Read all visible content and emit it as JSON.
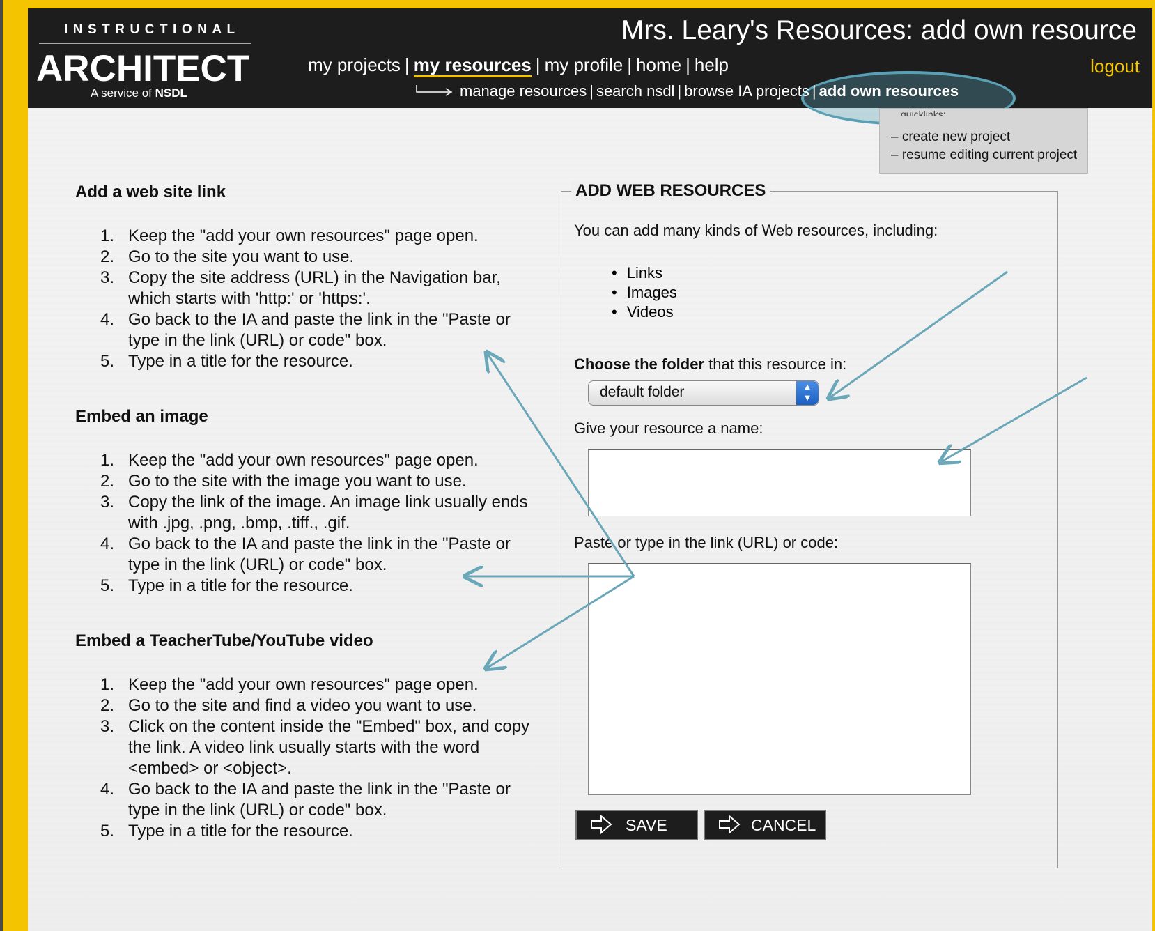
{
  "header": {
    "logo_top": "INSTRUCTIONAL",
    "logo_main": "ARCHITECT",
    "logo_sub": "A service of",
    "logo_nsdl": "NSDL",
    "title": "Mrs. Leary's Resources: add own resource",
    "nav": [
      {
        "label": "my projects",
        "active": false
      },
      {
        "label": "my resources",
        "active": true
      },
      {
        "label": "my profile",
        "active": false
      },
      {
        "label": "home",
        "active": false
      },
      {
        "label": "help",
        "active": false
      }
    ],
    "logout": "logout",
    "subnav": [
      {
        "label": "manage resources"
      },
      {
        "label": "search nsdl"
      },
      {
        "label": "browse IA projects"
      },
      {
        "label": "add own resources"
      }
    ],
    "colors": {
      "bar": "#1d1d1d",
      "accent": "#f5c400",
      "highlight": "#5aa0b5"
    }
  },
  "quicklinks": {
    "title": "quicklinks:",
    "items": [
      "– create new project",
      "– resume editing current project"
    ]
  },
  "instructions": [
    {
      "title": "Add a web site link",
      "steps": [
        "Keep the \"add your own resources\" page open.",
        "Go to the site you want to use.",
        "Copy the site address (URL) in the Navigation bar, which starts with 'http:' or 'https:'.",
        "Go back to the IA and paste the link in the \"Paste or type in the link (URL) or code\" box.",
        "Type in a title for the resource."
      ]
    },
    {
      "title": "Embed an image",
      "steps": [
        "Keep the \"add your own resources\" page open.",
        "Go to the site with the image you want to use.",
        "Copy the link of the image. An image link usually ends with .jpg, .png, .bmp, .tiff., .gif.",
        "Go back to the IA and paste the link in the \"Paste or type in the link (URL) or code\" box.",
        "Type in a title for the resource."
      ]
    },
    {
      "title": "Embed a TeacherTube/YouTube video",
      "steps": [
        "Keep the \"add your own resources\" page open.",
        "Go to the site and find a video you want to use.",
        "Click on the content inside the \"Embed\" box, and copy the link. A video link usually starts with the word <embed> or <object>.",
        "Go back to the IA and paste the link in the \"Paste or type in the link (URL) or code\" box.",
        "Type in a title for the resource."
      ]
    }
  ],
  "form": {
    "legend": "ADD WEB RESOURCES",
    "intro": "You can add many kinds of Web resources, including:",
    "types": [
      "Links",
      "Images",
      "Videos"
    ],
    "folder_label_bold": "Choose the folder",
    "folder_label_rest": " that this resource in:",
    "folder_value": "default folder",
    "name_label": "Give your resource a name:",
    "name_value": "",
    "code_label": "Paste or type in the link (URL) or code:",
    "code_value": "",
    "save": "SAVE",
    "cancel": "CANCEL"
  }
}
